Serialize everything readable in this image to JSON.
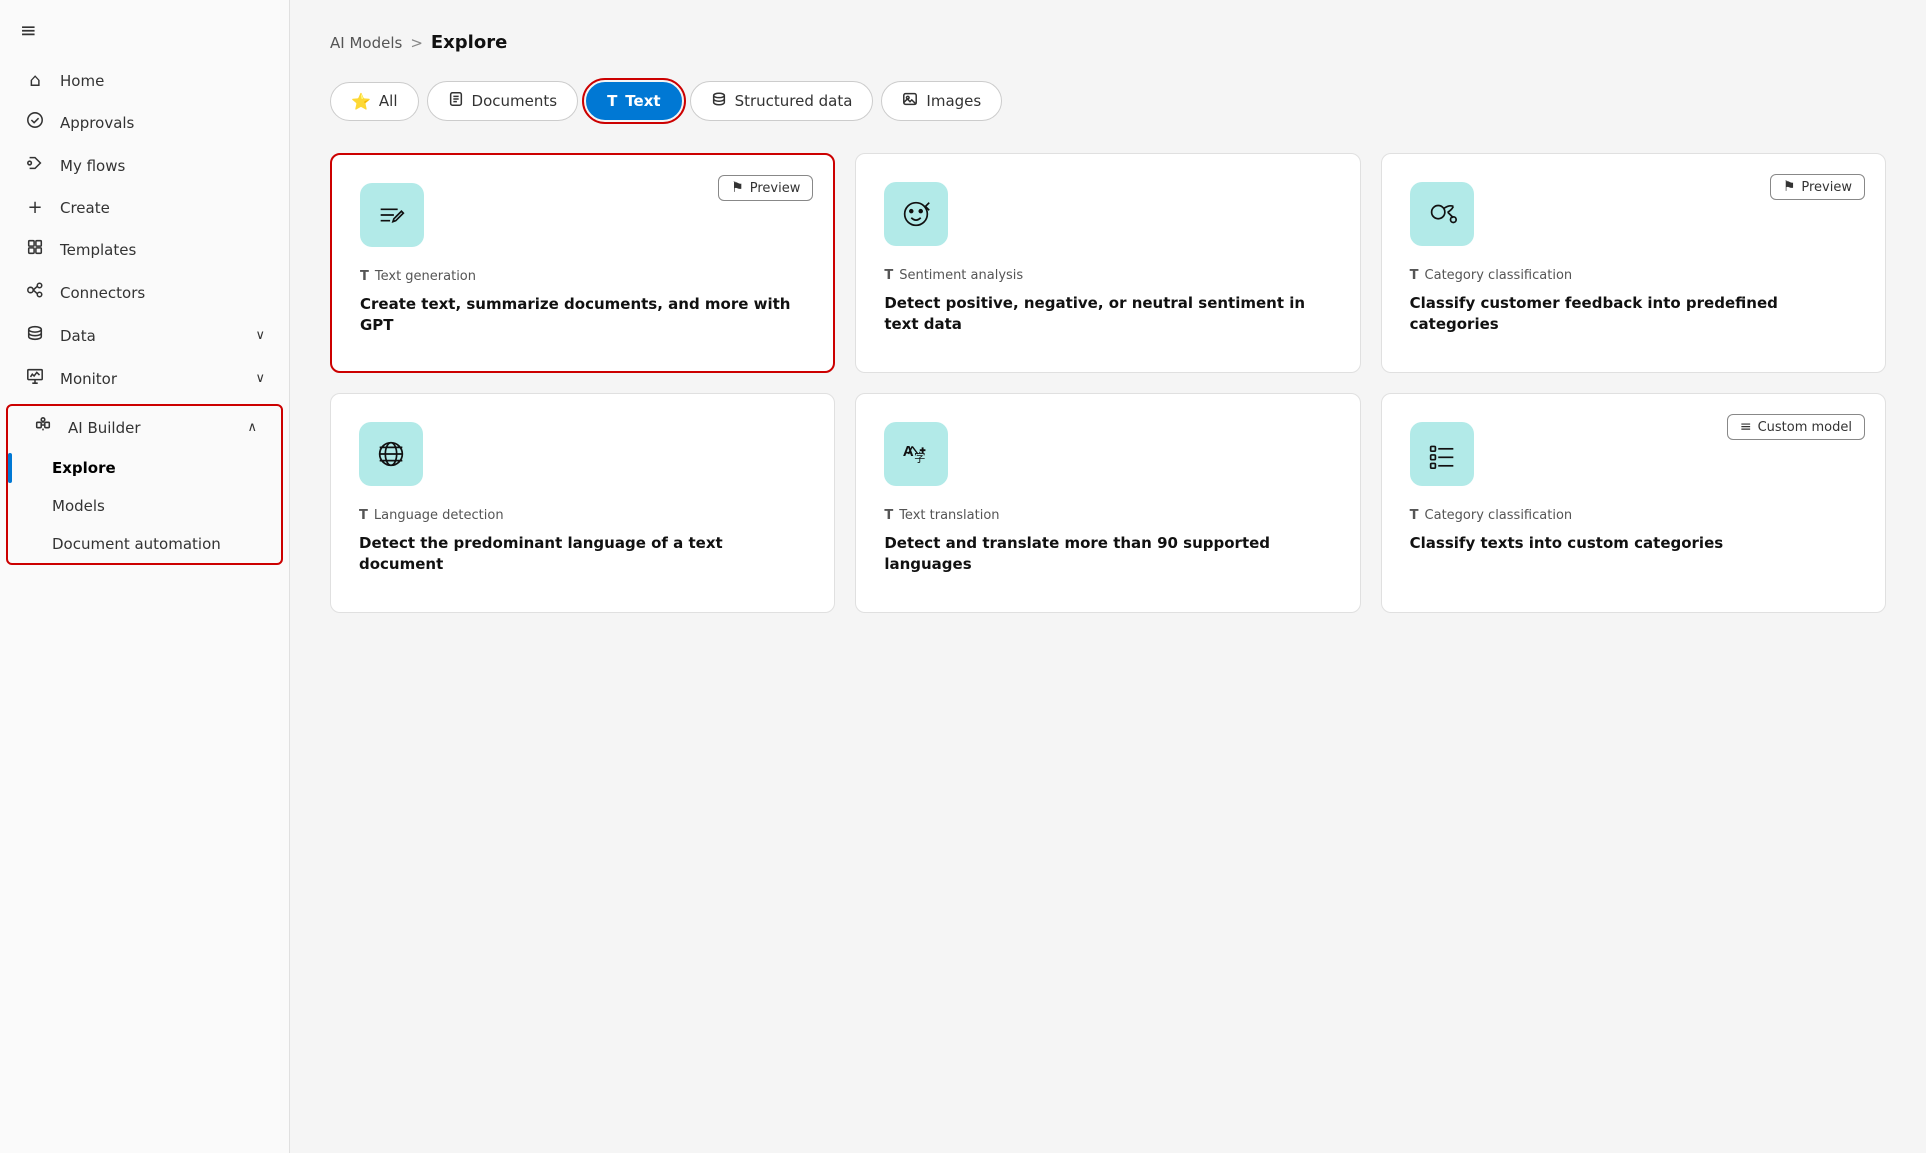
{
  "sidebar": {
    "hamburger_icon": "≡",
    "nav_items": [
      {
        "id": "home",
        "label": "Home",
        "icon": "⌂",
        "has_chevron": false
      },
      {
        "id": "approvals",
        "label": "Approvals",
        "icon": "◑",
        "has_chevron": false
      },
      {
        "id": "myflows",
        "label": "My flows",
        "icon": "↗",
        "has_chevron": false
      },
      {
        "id": "create",
        "label": "Create",
        "icon": "+",
        "has_chevron": false
      },
      {
        "id": "templates",
        "label": "Templates",
        "icon": "⊞",
        "has_chevron": false
      },
      {
        "id": "connectors",
        "label": "Connectors",
        "icon": "⚙",
        "has_chevron": false
      },
      {
        "id": "data",
        "label": "Data",
        "icon": "🗄",
        "has_chevron": true
      },
      {
        "id": "monitor",
        "label": "Monitor",
        "icon": "📊",
        "has_chevron": true
      },
      {
        "id": "ai_builder",
        "label": "AI Builder",
        "icon": "🤖",
        "has_chevron": true,
        "expanded": true
      },
      {
        "id": "explore",
        "label": "Explore",
        "sub": true,
        "active": true
      },
      {
        "id": "models",
        "label": "Models",
        "sub": true
      },
      {
        "id": "document_automation",
        "label": "Document automation",
        "sub": true
      }
    ]
  },
  "breadcrumb": {
    "parent": "AI Models",
    "separator": ">",
    "current": "Explore"
  },
  "tabs": [
    {
      "id": "all",
      "label": "All",
      "icon": "⭐",
      "active": false
    },
    {
      "id": "documents",
      "label": "Documents",
      "icon": "📄",
      "active": false
    },
    {
      "id": "text",
      "label": "Text",
      "icon": "T",
      "active": true
    },
    {
      "id": "structured_data",
      "label": "Structured data",
      "icon": "🗄",
      "active": false
    },
    {
      "id": "images",
      "label": "Images",
      "icon": "🖼",
      "active": false
    }
  ],
  "cards": [
    {
      "id": "text_generation",
      "highlighted": true,
      "badge": "Preview",
      "type_label": "Text generation",
      "title": "Create text, summarize documents, and more with GPT",
      "icon": "text_gen"
    },
    {
      "id": "sentiment_analysis",
      "highlighted": false,
      "badge": null,
      "type_label": "Sentiment analysis",
      "title": "Detect positive, negative, or neutral sentiment in text data",
      "icon": "sentiment"
    },
    {
      "id": "category_classification",
      "highlighted": false,
      "badge": "Preview",
      "type_label": "Category classification",
      "title": "Classify customer feedback into predefined categories",
      "icon": "category"
    },
    {
      "id": "language_detection",
      "highlighted": false,
      "badge": null,
      "type_label": "Language detection",
      "title": "Detect the predominant language of a text document",
      "icon": "language"
    },
    {
      "id": "text_translation",
      "highlighted": false,
      "badge": null,
      "type_label": "Text translation",
      "title": "Detect and translate more than 90 supported languages",
      "icon": "translation"
    },
    {
      "id": "custom_category",
      "highlighted": false,
      "badge": "Custom model",
      "type_label": "Category classification",
      "title": "Classify texts into custom categories",
      "icon": "custom_list"
    }
  ],
  "colors": {
    "accent_blue": "#0078d4",
    "highlight_red": "#cc0000",
    "card_icon_bg": "#b2eae8"
  }
}
